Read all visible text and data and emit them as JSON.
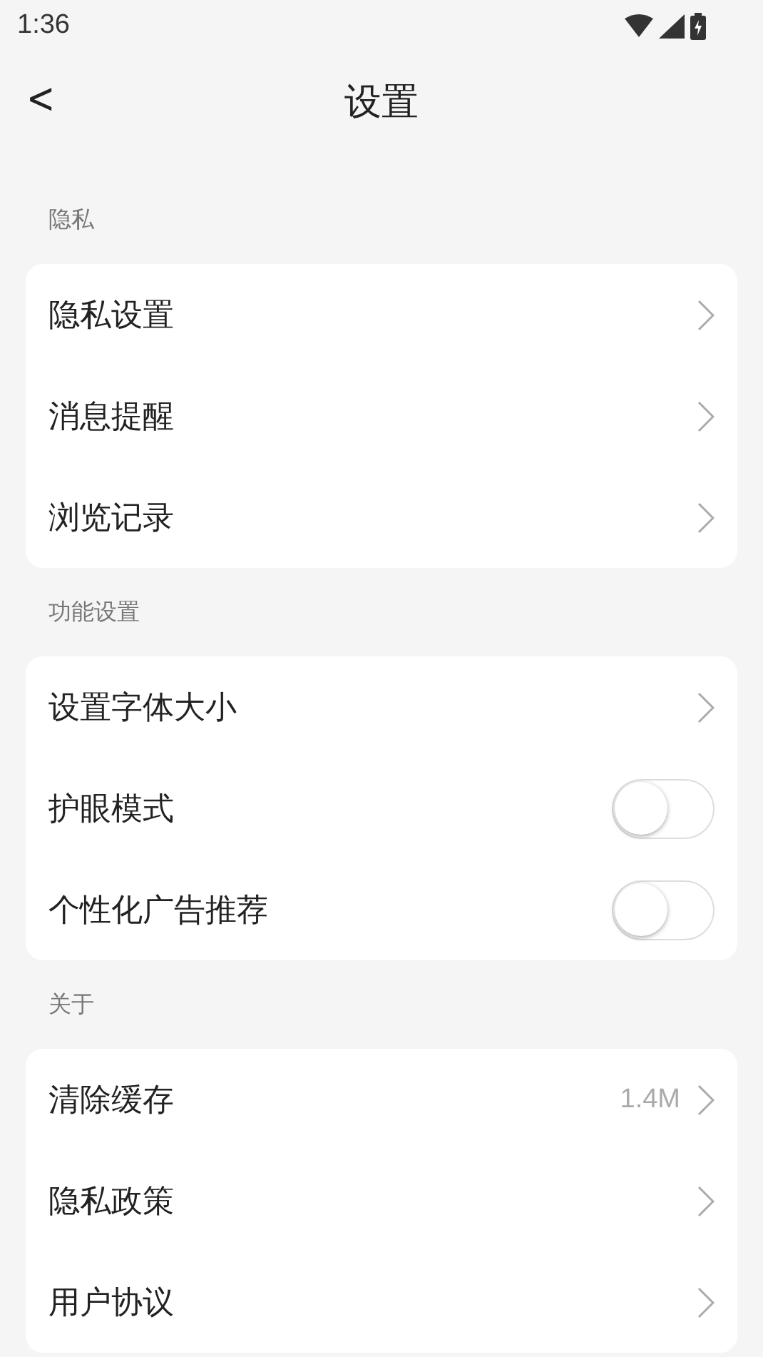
{
  "status_bar": {
    "time": "1:36"
  },
  "header": {
    "back": "<",
    "title": "设置"
  },
  "sections": [
    {
      "title": "隐私",
      "items": [
        {
          "kind": "link",
          "label": "隐私设置"
        },
        {
          "kind": "link",
          "label": "消息提醒"
        },
        {
          "kind": "link",
          "label": "浏览记录"
        }
      ]
    },
    {
      "title": "功能设置",
      "items": [
        {
          "kind": "link",
          "label": "设置字体大小"
        },
        {
          "kind": "toggle",
          "label": "护眼模式",
          "on": false
        },
        {
          "kind": "toggle",
          "label": "个性化广告推荐",
          "on": false
        }
      ]
    },
    {
      "title": "关于",
      "items": [
        {
          "kind": "link",
          "label": "清除缓存",
          "value": "1.4M"
        },
        {
          "kind": "link",
          "label": "隐私政策"
        },
        {
          "kind": "link",
          "label": "用户协议"
        }
      ]
    }
  ]
}
